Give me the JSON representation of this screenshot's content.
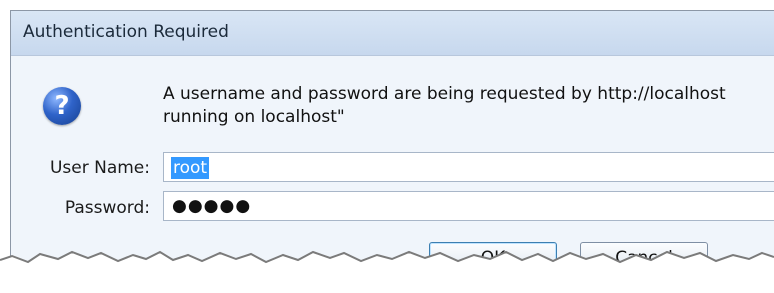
{
  "window": {
    "title": "Authentication Required"
  },
  "dialog": {
    "icon": "question-icon",
    "message_line1": "A username and password are being requested by http://localhost",
    "message_line2": "running on localhost\"",
    "username_label": "User Name:",
    "username_value": "root",
    "password_label": "Password:",
    "password_mask": "●●●●●",
    "ok_label": "OK",
    "cancel_label": "Cancel"
  },
  "colors": {
    "title_bar": "#c7d8ee",
    "body_bg": "#f0f5fb",
    "selection": "#3399ff"
  }
}
